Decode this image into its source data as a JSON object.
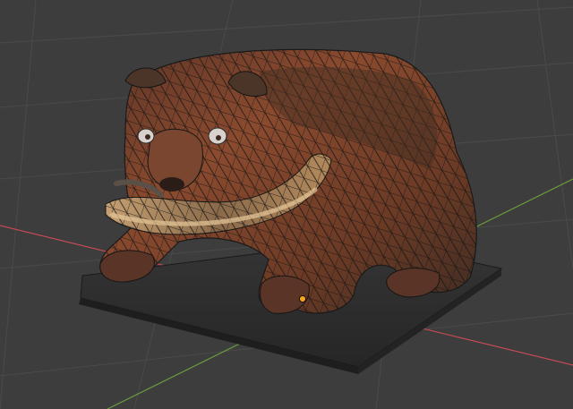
{
  "viewport": {
    "background": "#3d3d3d",
    "grid_color": "#4a4a4a",
    "x_axis_color": "#c64a52",
    "y_axis_color": "#6a9a3a",
    "object_origin_color": "#f5a31a"
  },
  "scene": {
    "object_icon": "bear-model",
    "wireframe_color": "#151515",
    "base_color": "#2e2e2e",
    "fur_colors": [
      "#6b3a25",
      "#8a4a2e",
      "#4a3528"
    ],
    "fish_colors": [
      "#b0845a",
      "#d8b282",
      "#5a5048"
    ]
  }
}
